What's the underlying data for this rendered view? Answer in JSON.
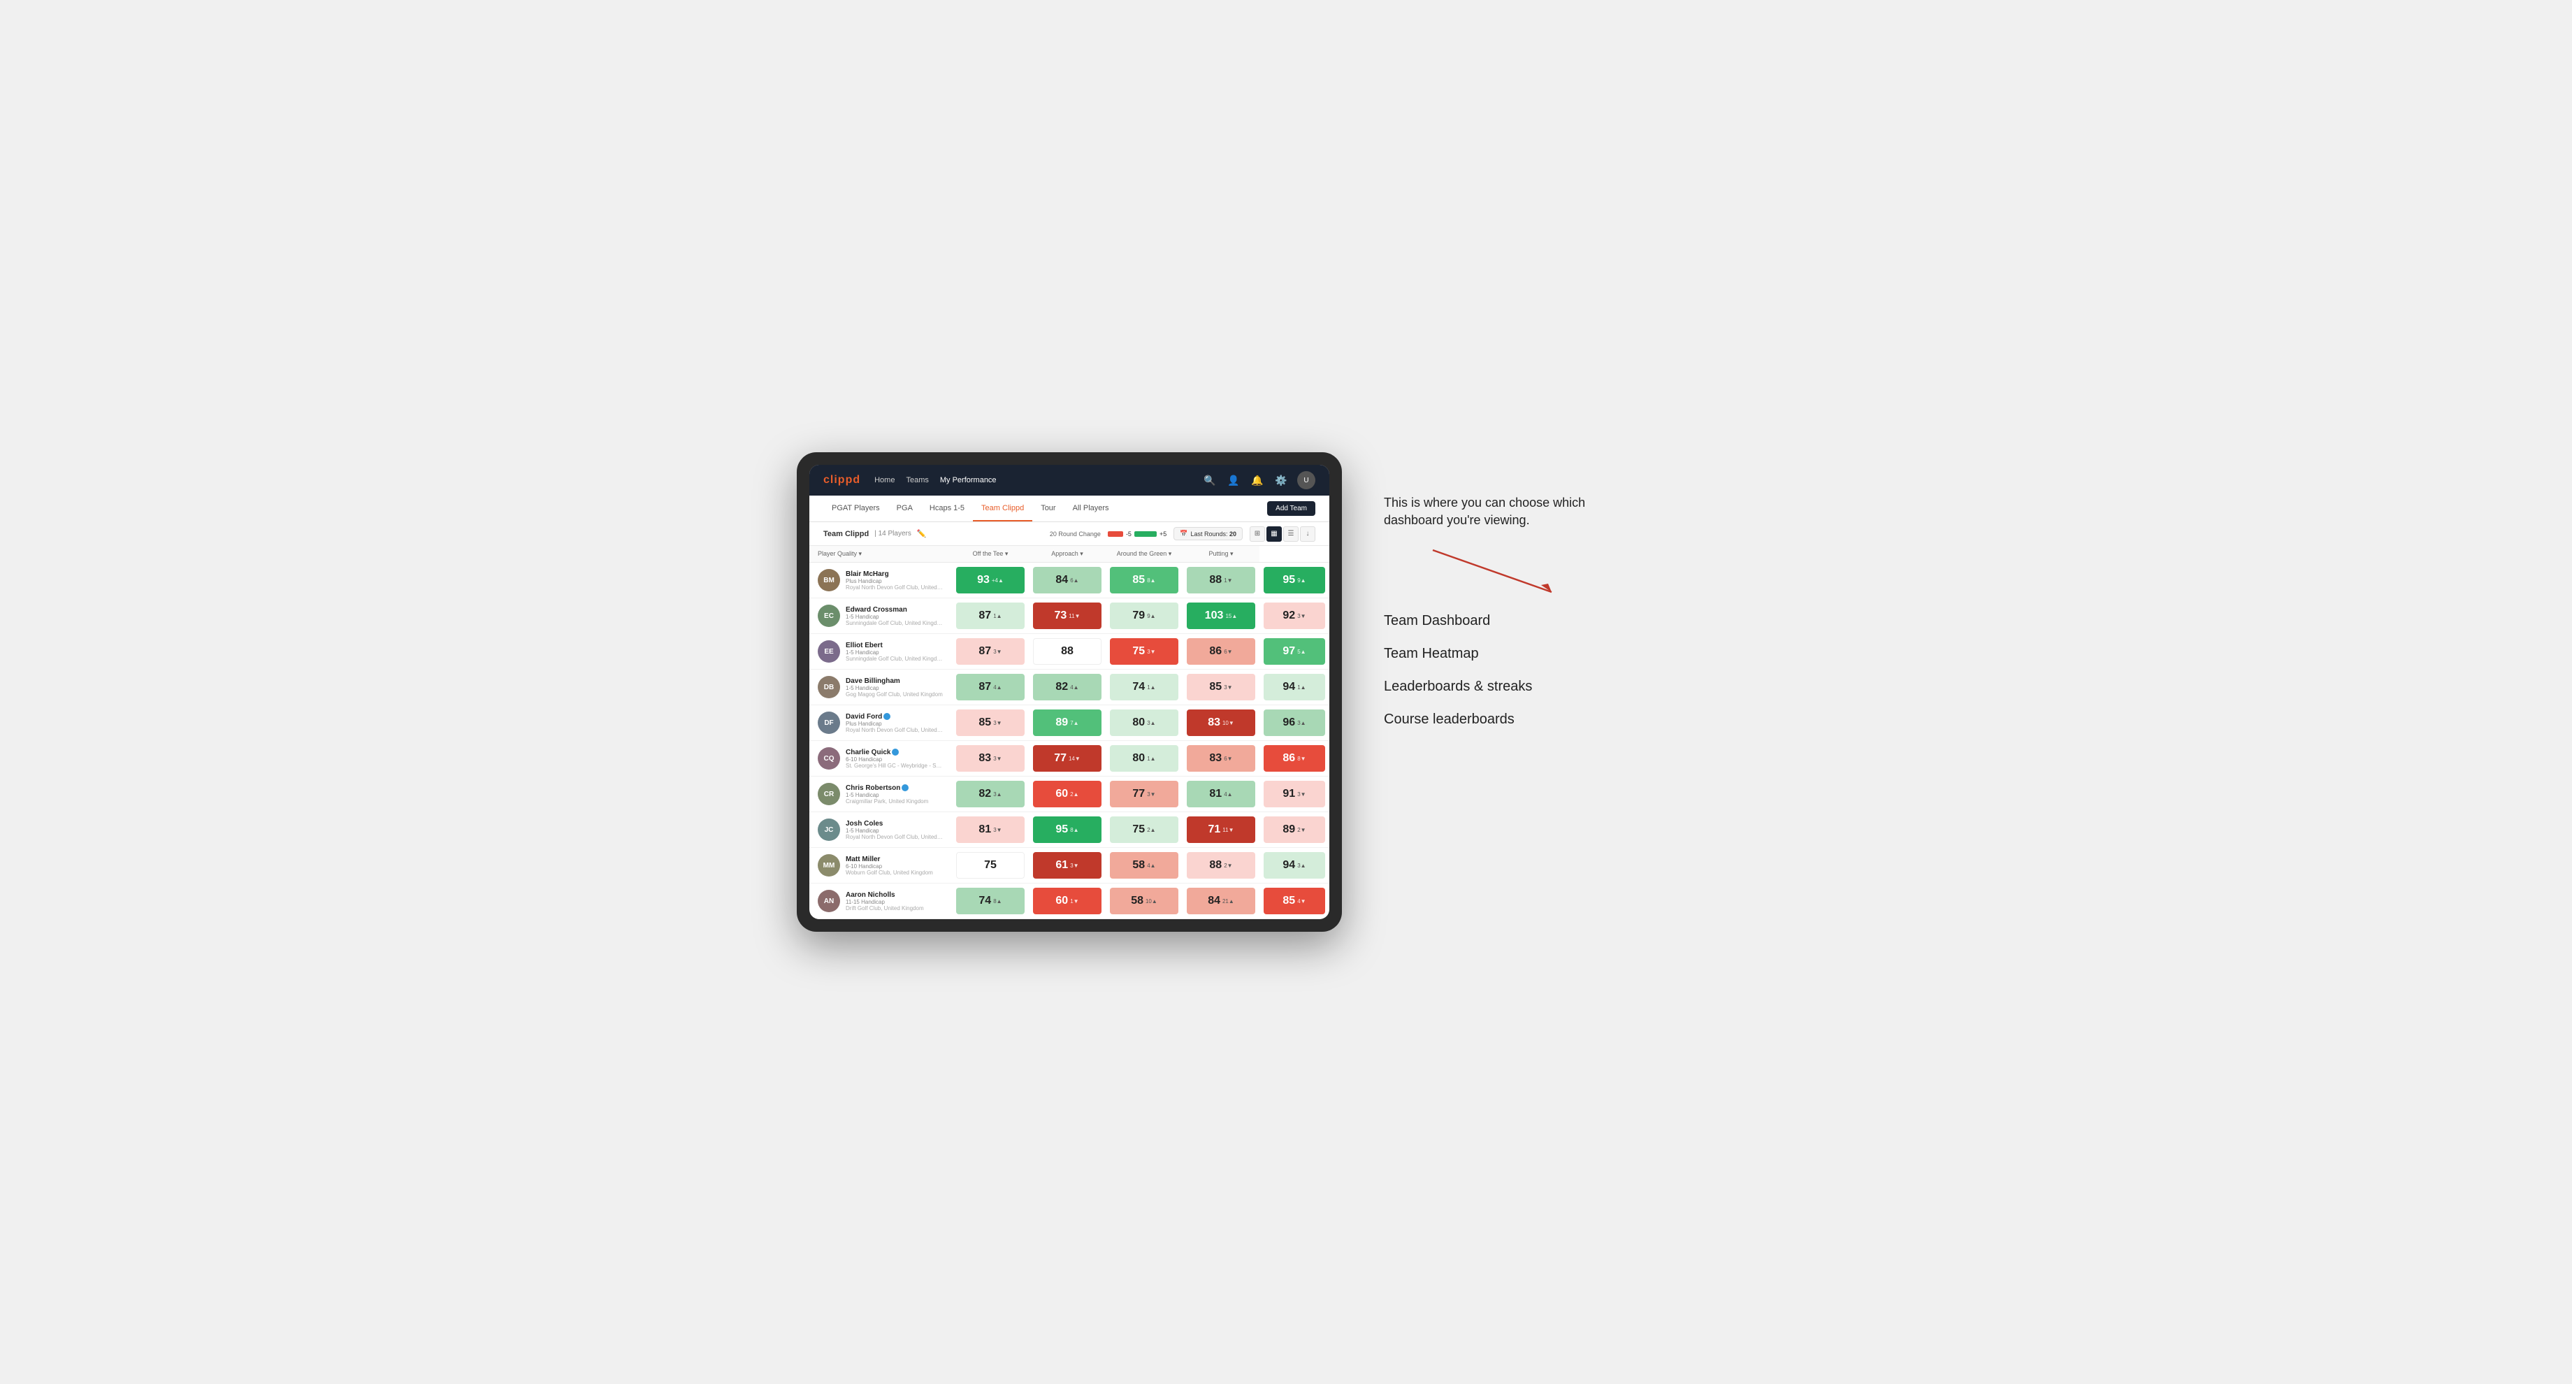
{
  "app": {
    "logo": "clippd",
    "nav": {
      "links": [
        "Home",
        "Teams",
        "My Performance"
      ],
      "active": "My Performance"
    },
    "sub_nav": {
      "links": [
        "PGAT Players",
        "PGA",
        "Hcaps 1-5",
        "Team Clippd",
        "Tour",
        "All Players"
      ],
      "active": "Team Clippd"
    },
    "add_team_label": "Add Team"
  },
  "team_header": {
    "name": "Team Clippd",
    "separator": "|",
    "count": "14 Players",
    "round_change_label": "20 Round Change",
    "bar_neg": "-5",
    "bar_pos": "+5",
    "last_rounds_label": "Last Rounds:",
    "last_rounds_value": "20"
  },
  "table": {
    "columns": {
      "player": "Player Quality ▾",
      "off_tee": "Off the Tee ▾",
      "approach": "Approach ▾",
      "around_green": "Around the Green ▾",
      "putting": "Putting ▾"
    },
    "players": [
      {
        "name": "Blair McHarg",
        "handicap": "Plus Handicap",
        "club": "Royal North Devon Golf Club, United Kingdom",
        "avatar_class": "av-1",
        "initials": "BM",
        "quality": {
          "value": 93,
          "change": "+4",
          "dir": "up",
          "bg": "bg-green-strong",
          "text": "white"
        },
        "off_tee": {
          "value": 84,
          "change": "6",
          "dir": "up",
          "bg": "bg-green-light",
          "text": "dark"
        },
        "approach": {
          "value": 85,
          "change": "8",
          "dir": "up",
          "bg": "bg-green-mid",
          "text": "white"
        },
        "around_green": {
          "value": 88,
          "change": "1",
          "dir": "down",
          "bg": "bg-green-light",
          "text": "dark"
        },
        "putting": {
          "value": 95,
          "change": "9",
          "dir": "up",
          "bg": "bg-green-strong",
          "text": "white"
        }
      },
      {
        "name": "Edward Crossman",
        "handicap": "1-5 Handicap",
        "club": "Sunningdale Golf Club, United Kingdom",
        "avatar_class": "av-2",
        "initials": "EC",
        "quality": {
          "value": 87,
          "change": "1",
          "dir": "up",
          "bg": "bg-green-pale",
          "text": "dark"
        },
        "off_tee": {
          "value": 73,
          "change": "11",
          "dir": "down",
          "bg": "bg-red-strong",
          "text": "white"
        },
        "approach": {
          "value": 79,
          "change": "9",
          "dir": "up",
          "bg": "bg-green-pale",
          "text": "dark"
        },
        "around_green": {
          "value": 103,
          "change": "15",
          "dir": "up",
          "bg": "bg-green-strong",
          "text": "white"
        },
        "putting": {
          "value": 92,
          "change": "3",
          "dir": "down",
          "bg": "bg-red-pale",
          "text": "dark"
        }
      },
      {
        "name": "Elliot Ebert",
        "handicap": "1-5 Handicap",
        "club": "Sunningdale Golf Club, United Kingdom",
        "avatar_class": "av-3",
        "initials": "EE",
        "quality": {
          "value": 87,
          "change": "3",
          "dir": "down",
          "bg": "bg-red-pale",
          "text": "dark"
        },
        "off_tee": {
          "value": 88,
          "change": "",
          "dir": "none",
          "bg": "bg-white",
          "text": "dark"
        },
        "approach": {
          "value": 75,
          "change": "3",
          "dir": "down",
          "bg": "bg-red-mid",
          "text": "white"
        },
        "around_green": {
          "value": 86,
          "change": "6",
          "dir": "down",
          "bg": "bg-red-light",
          "text": "dark"
        },
        "putting": {
          "value": 97,
          "change": "5",
          "dir": "up",
          "bg": "bg-green-mid",
          "text": "white"
        }
      },
      {
        "name": "Dave Billingham",
        "handicap": "1-5 Handicap",
        "club": "Gog Magog Golf Club, United Kingdom",
        "avatar_class": "av-4",
        "initials": "DB",
        "quality": {
          "value": 87,
          "change": "4",
          "dir": "up",
          "bg": "bg-green-light",
          "text": "dark"
        },
        "off_tee": {
          "value": 82,
          "change": "4",
          "dir": "up",
          "bg": "bg-green-light",
          "text": "dark"
        },
        "approach": {
          "value": 74,
          "change": "1",
          "dir": "up",
          "bg": "bg-green-pale",
          "text": "dark"
        },
        "around_green": {
          "value": 85,
          "change": "3",
          "dir": "down",
          "bg": "bg-red-pale",
          "text": "dark"
        },
        "putting": {
          "value": 94,
          "change": "1",
          "dir": "up",
          "bg": "bg-green-pale",
          "text": "dark"
        }
      },
      {
        "name": "David Ford",
        "handicap": "Plus Handicap",
        "club": "Royal North Devon Golf Club, United Kingdom",
        "avatar_class": "av-5",
        "initials": "DF",
        "verified": true,
        "quality": {
          "value": 85,
          "change": "3",
          "dir": "down",
          "bg": "bg-red-pale",
          "text": "dark"
        },
        "off_tee": {
          "value": 89,
          "change": "7",
          "dir": "up",
          "bg": "bg-green-mid",
          "text": "white"
        },
        "approach": {
          "value": 80,
          "change": "3",
          "dir": "up",
          "bg": "bg-green-pale",
          "text": "dark"
        },
        "around_green": {
          "value": 83,
          "change": "10",
          "dir": "down",
          "bg": "bg-red-strong",
          "text": "white"
        },
        "putting": {
          "value": 96,
          "change": "3",
          "dir": "up",
          "bg": "bg-green-light",
          "text": "dark"
        }
      },
      {
        "name": "Charlie Quick",
        "handicap": "6-10 Handicap",
        "club": "St. George's Hill GC - Weybridge - Surrey, Uni...",
        "avatar_class": "av-6",
        "initials": "CQ",
        "verified": true,
        "quality": {
          "value": 83,
          "change": "3",
          "dir": "down",
          "bg": "bg-red-pale",
          "text": "dark"
        },
        "off_tee": {
          "value": 77,
          "change": "14",
          "dir": "down",
          "bg": "bg-red-strong",
          "text": "white"
        },
        "approach": {
          "value": 80,
          "change": "1",
          "dir": "up",
          "bg": "bg-green-pale",
          "text": "dark"
        },
        "around_green": {
          "value": 83,
          "change": "6",
          "dir": "down",
          "bg": "bg-red-light",
          "text": "dark"
        },
        "putting": {
          "value": 86,
          "change": "8",
          "dir": "down",
          "bg": "bg-red-mid",
          "text": "white"
        }
      },
      {
        "name": "Chris Robertson",
        "handicap": "1-5 Handicap",
        "club": "Craigmillar Park, United Kingdom",
        "avatar_class": "av-7",
        "initials": "CR",
        "verified": true,
        "quality": {
          "value": 82,
          "change": "3",
          "dir": "up",
          "bg": "bg-green-light",
          "text": "dark"
        },
        "off_tee": {
          "value": 60,
          "change": "2",
          "dir": "up",
          "bg": "bg-red-mid",
          "text": "white"
        },
        "approach": {
          "value": 77,
          "change": "3",
          "dir": "down",
          "bg": "bg-red-light",
          "text": "dark"
        },
        "around_green": {
          "value": 81,
          "change": "4",
          "dir": "up",
          "bg": "bg-green-light",
          "text": "dark"
        },
        "putting": {
          "value": 91,
          "change": "3",
          "dir": "down",
          "bg": "bg-red-pale",
          "text": "dark"
        }
      },
      {
        "name": "Josh Coles",
        "handicap": "1-5 Handicap",
        "club": "Royal North Devon Golf Club, United Kingdom",
        "avatar_class": "av-8",
        "initials": "JC",
        "quality": {
          "value": 81,
          "change": "3",
          "dir": "down",
          "bg": "bg-red-pale",
          "text": "dark"
        },
        "off_tee": {
          "value": 95,
          "change": "8",
          "dir": "up",
          "bg": "bg-green-strong",
          "text": "white"
        },
        "approach": {
          "value": 75,
          "change": "2",
          "dir": "up",
          "bg": "bg-green-pale",
          "text": "dark"
        },
        "around_green": {
          "value": 71,
          "change": "11",
          "dir": "down",
          "bg": "bg-red-strong",
          "text": "white"
        },
        "putting": {
          "value": 89,
          "change": "2",
          "dir": "down",
          "bg": "bg-red-pale",
          "text": "dark"
        }
      },
      {
        "name": "Matt Miller",
        "handicap": "6-10 Handicap",
        "club": "Woburn Golf Club, United Kingdom",
        "avatar_class": "av-9",
        "initials": "MM",
        "quality": {
          "value": 75,
          "change": "",
          "dir": "none",
          "bg": "bg-white",
          "text": "dark"
        },
        "off_tee": {
          "value": 61,
          "change": "3",
          "dir": "down",
          "bg": "bg-red-strong",
          "text": "white"
        },
        "approach": {
          "value": 58,
          "change": "4",
          "dir": "up",
          "bg": "bg-red-light",
          "text": "dark"
        },
        "around_green": {
          "value": 88,
          "change": "2",
          "dir": "down",
          "bg": "bg-red-pale",
          "text": "dark"
        },
        "putting": {
          "value": 94,
          "change": "3",
          "dir": "up",
          "bg": "bg-green-pale",
          "text": "dark"
        }
      },
      {
        "name": "Aaron Nicholls",
        "handicap": "11-15 Handicap",
        "club": "Drift Golf Club, United Kingdom",
        "avatar_class": "av-10",
        "initials": "AN",
        "quality": {
          "value": 74,
          "change": "8",
          "dir": "up",
          "bg": "bg-green-light",
          "text": "dark"
        },
        "off_tee": {
          "value": 60,
          "change": "1",
          "dir": "down",
          "bg": "bg-red-mid",
          "text": "white"
        },
        "approach": {
          "value": 58,
          "change": "10",
          "dir": "up",
          "bg": "bg-red-light",
          "text": "dark"
        },
        "around_green": {
          "value": 84,
          "change": "21",
          "dir": "up",
          "bg": "bg-red-light",
          "text": "dark"
        },
        "putting": {
          "value": 85,
          "change": "4",
          "dir": "down",
          "bg": "bg-red-mid",
          "text": "white"
        }
      }
    ]
  },
  "annotation": {
    "intro_text": "This is where you can choose which dashboard you're viewing.",
    "items": [
      "Team Dashboard",
      "Team Heatmap",
      "Leaderboards & streaks",
      "Course leaderboards"
    ]
  }
}
